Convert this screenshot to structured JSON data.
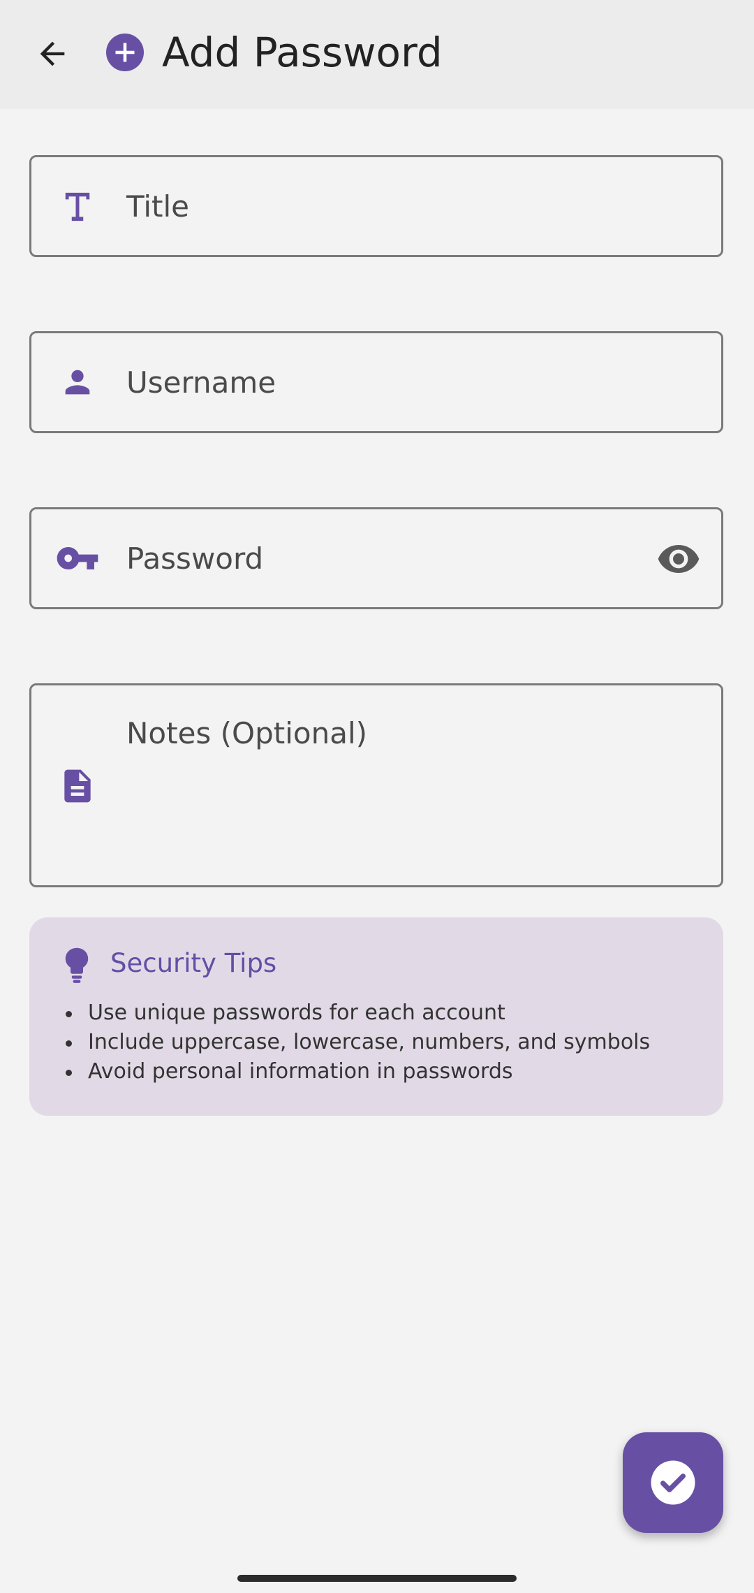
{
  "header": {
    "title": "Add Password",
    "back_icon": "arrow-back-icon",
    "title_icon": "add-circle-icon"
  },
  "form": {
    "title_field": {
      "placeholder": "Title",
      "icon": "title-t-icon"
    },
    "username_field": {
      "placeholder": "Username",
      "icon": "person-icon"
    },
    "password_field": {
      "placeholder": "Password",
      "icon": "key-icon",
      "toggle_icon": "eye-icon"
    },
    "notes_field": {
      "placeholder": "Notes (Optional)",
      "icon": "document-icon"
    }
  },
  "tips": {
    "icon": "lightbulb-icon",
    "title": "Security Tips",
    "items": [
      "Use unique passwords for each account",
      "Include uppercase, lowercase, numbers, and symbols",
      "Avoid personal information in passwords"
    ]
  },
  "fab": {
    "icon": "check-icon"
  },
  "colors": {
    "accent": "#6750a4",
    "background": "#f3f3f3",
    "app_bar": "#ececec",
    "tips_card": "#e1dae6",
    "outline": "#7a7a7a"
  }
}
